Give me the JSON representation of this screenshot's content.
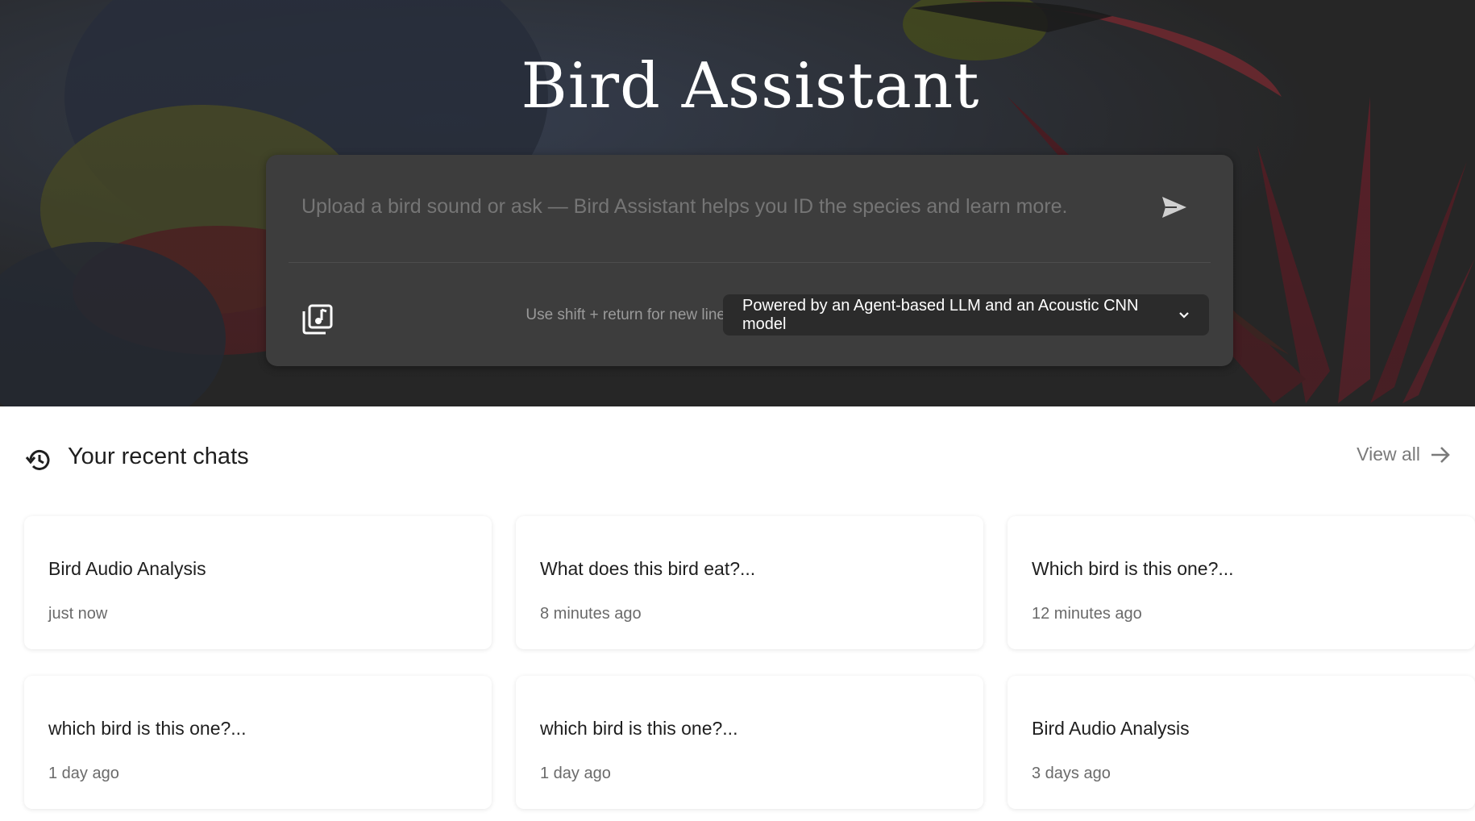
{
  "hero": {
    "title": "Bird Assistant"
  },
  "composer": {
    "placeholder": "Upload a bird sound or ask — Bird Assistant helps you ID the species and learn more.",
    "hint": "Use shift + return for new line",
    "model_selected": "Powered by an Agent-based LLM and an Acoustic CNN model",
    "send_icon": "send-icon",
    "upload_icon": "audio-library-icon",
    "dropdown_icon": "chevron-down-icon"
  },
  "recent": {
    "title": "Your recent chats",
    "view_all": "View all",
    "icon": "history-icon",
    "chats": [
      {
        "title": "Bird Audio Analysis",
        "time": "just now"
      },
      {
        "title": "What does this bird eat?...",
        "time": "8 minutes ago"
      },
      {
        "title": "Which bird is this one?...",
        "time": "12 minutes ago"
      },
      {
        "title": "which bird is this one?...",
        "time": "1 day ago"
      },
      {
        "title": "which bird is this one?...",
        "time": "1 day ago"
      },
      {
        "title": "Bird Audio Analysis",
        "time": "3 days ago"
      }
    ]
  },
  "colors": {
    "hero_overlay": "#3a3a3a",
    "composer_bg": "#3d3d3d",
    "select_bg": "#2b2b2b",
    "accent_red": "#b5202b",
    "accent_yellow": "#b8b82a"
  }
}
